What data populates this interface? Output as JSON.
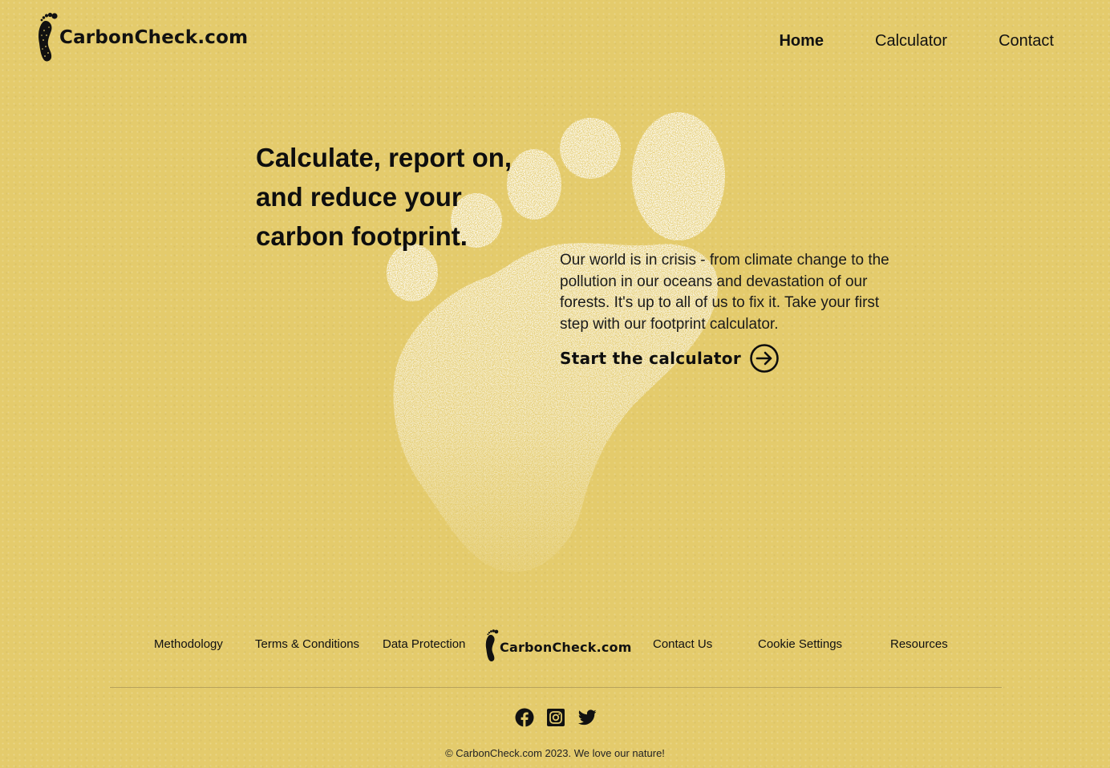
{
  "header": {
    "logo_text": "CarbonCheck.com",
    "nav": [
      {
        "label": "Home",
        "active": true
      },
      {
        "label": "Calculator",
        "active": false
      },
      {
        "label": "Contact",
        "active": false
      }
    ]
  },
  "hero": {
    "title": "Calculate, report on, and reduce your carbon footprint.",
    "body": "Our world is in crisis - from climate change to the pollution in our oceans and devastation of our forests. It's up to all of us to fix it. Take your first step with our footprint calculator.",
    "cta_label": "Start the calculator",
    "cta_icon": "arrow-right-circle-icon"
  },
  "footer": {
    "links_left": [
      "Methodology",
      "Terms & Conditions",
      "Data Protection"
    ],
    "logo_text": "CarbonCheck.com",
    "links_right": [
      "Contact Us",
      "Cookie Settings",
      "Resources"
    ],
    "socials": [
      "facebook-icon",
      "instagram-icon",
      "twitter-icon"
    ],
    "copyright": "© CarbonCheck.com 2023. We love our nature!"
  },
  "colors": {
    "background": "#e4cb6c",
    "text": "#111111",
    "footprint": "#ffffff"
  }
}
